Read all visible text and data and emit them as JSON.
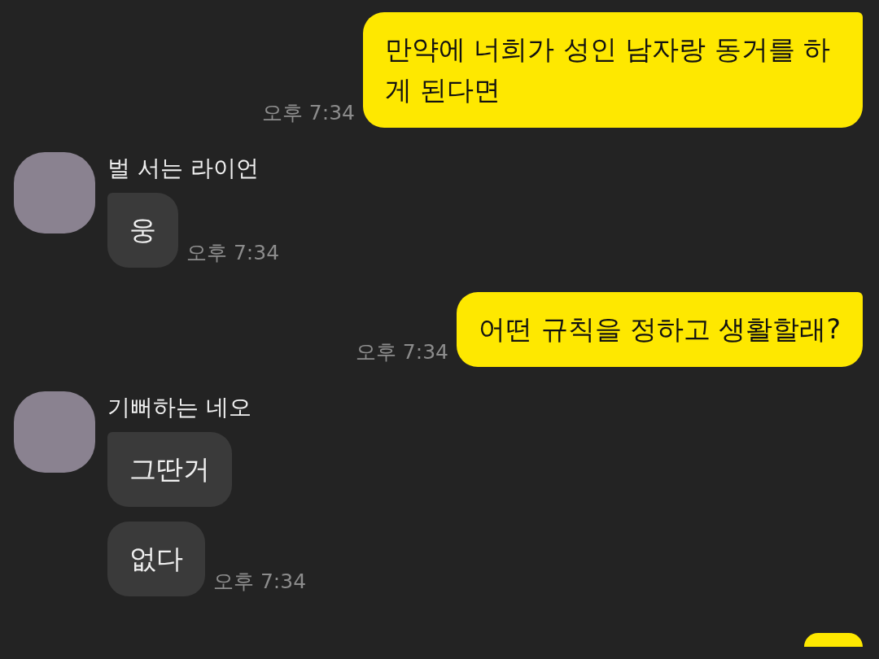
{
  "messages": [
    {
      "kind": "outgoing",
      "bubbles": [
        "만약에 너희가 성인 남자랑 동거를 하게 된다면"
      ],
      "time": "오후 7:34"
    },
    {
      "kind": "incoming",
      "sender": "벌 서는 라이언",
      "bubbles": [
        "웅"
      ],
      "time": "오후 7:34"
    },
    {
      "kind": "outgoing",
      "bubbles": [
        "어떤 규칙을 정하고 생활할래?"
      ],
      "time": "오후 7:34"
    },
    {
      "kind": "incoming",
      "sender": "기뻐하는 네오",
      "bubbles": [
        "그딴거",
        "없다"
      ],
      "time": "오후 7:34"
    }
  ]
}
